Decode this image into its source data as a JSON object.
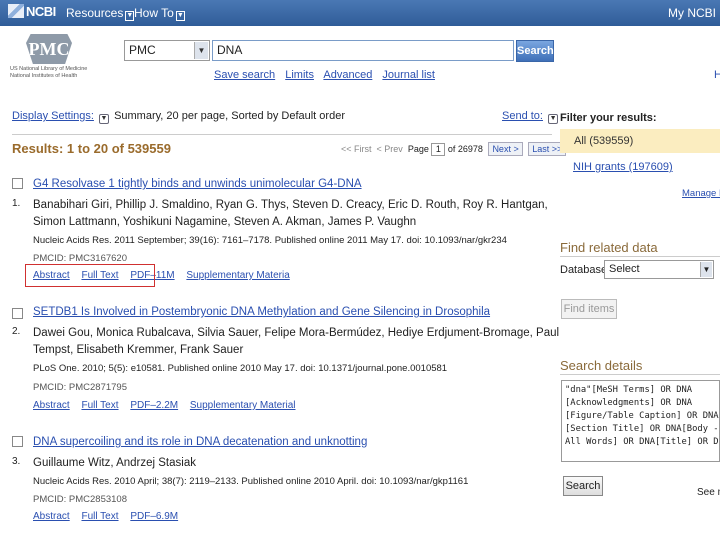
{
  "topbar": {
    "logo": "NCBI",
    "resources": "Resources",
    "howto": "How To",
    "myncbi": "My NCBI Sig"
  },
  "header": {
    "logo_text": "PMC",
    "logo_sub": "US National Library of Medicine National Institutes of Health",
    "db_value": "PMC",
    "query": "DNA",
    "search_label": "Search",
    "links": [
      "Save search",
      "Limits",
      "Advanced",
      "Journal list"
    ],
    "help_fragment": "H"
  },
  "display": {
    "settings_label": "Display Settings:",
    "summary_text": "Summary, 20 per page, Sorted by Default order",
    "send_to": "Send to:"
  },
  "results_header": {
    "count_text": "Results: 1 to 20 of 539559",
    "first": "<< First",
    "prev": "< Prev",
    "page_label": "Page",
    "page_value": "1",
    "of_text": "of 26978",
    "next": "Next >",
    "last": "Last >>"
  },
  "results": [
    {
      "num": "1.",
      "title": "G4 Resolvase 1 tightly binds and unwinds unimolecular G4-DNA",
      "authors": "Banabihari Giri, Phillip J. Smaldino, Ryan G. Thys, Steven D. Creacy, Eric D. Routh, Roy R. Hantgan, Simon Lattmann, Yoshikuni Nagamine, Steven A. Akman, James P. Vaughn",
      "cite": "Nucleic Acids Res. 2011 September; 39(16): 7161–7178. Published online 2011 May 17. doi: 10.1093/nar/gkr234",
      "pmc": "PMCID: PMC3167620",
      "links": [
        "Abstract",
        "Full Text",
        "PDF–11M",
        "Supplementary Materia"
      ]
    },
    {
      "num": "2.",
      "title": "SETDB1 Is Involved in Postembryonic DNA Methylation and Gene Silencing in Drosophila",
      "authors": "Dawei Gou, Monica Rubalcava, Silvia Sauer, Felipe Mora-Bermúdez, Hediye Erdjument-Bromage, Paul Tempst, Elisabeth Kremmer, Frank Sauer",
      "cite": "PLoS One. 2010; 5(5): e10581. Published online 2010 May 17. doi: 10.1371/journal.pone.0010581",
      "pmc": "PMCID: PMC2871795",
      "links": [
        "Abstract",
        "Full Text",
        "PDF–2.2M",
        "Supplementary Material"
      ]
    },
    {
      "num": "3.",
      "title": "DNA supercoiling and its role in DNA decatenation and unknotting",
      "authors": "Guillaume Witz, Andrzej Stasiak",
      "cite": "Nucleic Acids Res. 2010 April; 38(7): 2119–2133. Published online 2010 April. doi: 10.1093/nar/gkp1161",
      "pmc": "PMCID: PMC2853108",
      "links": [
        "Abstract",
        "Full Text",
        "PDF–6.9M"
      ]
    }
  ],
  "sidebar": {
    "filter_title": "Filter your results:",
    "filter_all": "All (539559)",
    "filter_nih": "NIH grants (197609)",
    "manage_filters": "Manage Fi",
    "related_title": "Find related data",
    "database_label": "Database:",
    "database_value": "Select",
    "find_items": "Find items",
    "details_title": "Search details",
    "details_text": "\"dna\"[MeSH Terms] OR DNA\n[Acknowledgments] OR DNA\n[Figure/Table Caption] OR DNA\n[Section Title] OR DNA[Body -\nAll Words] OR DNA[Title] OR DN",
    "search_btn": "Search",
    "see_more": "See m"
  },
  "colors": {
    "topbar": "#3a6aa8",
    "link": "#2a4fb0",
    "results_count": "#9a6b2c",
    "filter_highlight": "#fbedc0",
    "highlight_box": "#d03030"
  }
}
